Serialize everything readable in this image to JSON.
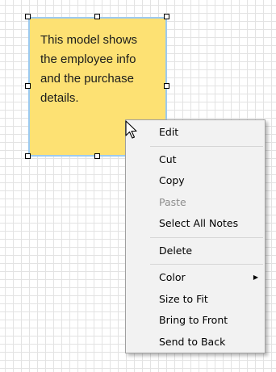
{
  "note": {
    "text": "This model shows\nthe employee info\nand the purchase\ndetails.",
    "fill_color": "#fde173",
    "selection_border_color": "#9ccaf0"
  },
  "cursor": {
    "icon": "arrow-cursor-icon"
  },
  "context_menu": {
    "items": [
      {
        "label": "Edit",
        "enabled": true
      },
      {
        "separator": true
      },
      {
        "label": "Cut",
        "enabled": true
      },
      {
        "label": "Copy",
        "enabled": true
      },
      {
        "label": "Paste",
        "enabled": false
      },
      {
        "label": "Select All Notes",
        "enabled": true
      },
      {
        "separator": true
      },
      {
        "label": "Delete",
        "enabled": true
      },
      {
        "separator": true
      },
      {
        "label": "Color",
        "enabled": true,
        "submenu": true,
        "submenu_icon": "chevron-right-icon"
      },
      {
        "label": "Size to Fit",
        "enabled": true
      },
      {
        "label": "Bring to Front",
        "enabled": true
      },
      {
        "label": "Send to Back",
        "enabled": true
      }
    ],
    "disabled_text_color": "#8d8d8d"
  }
}
